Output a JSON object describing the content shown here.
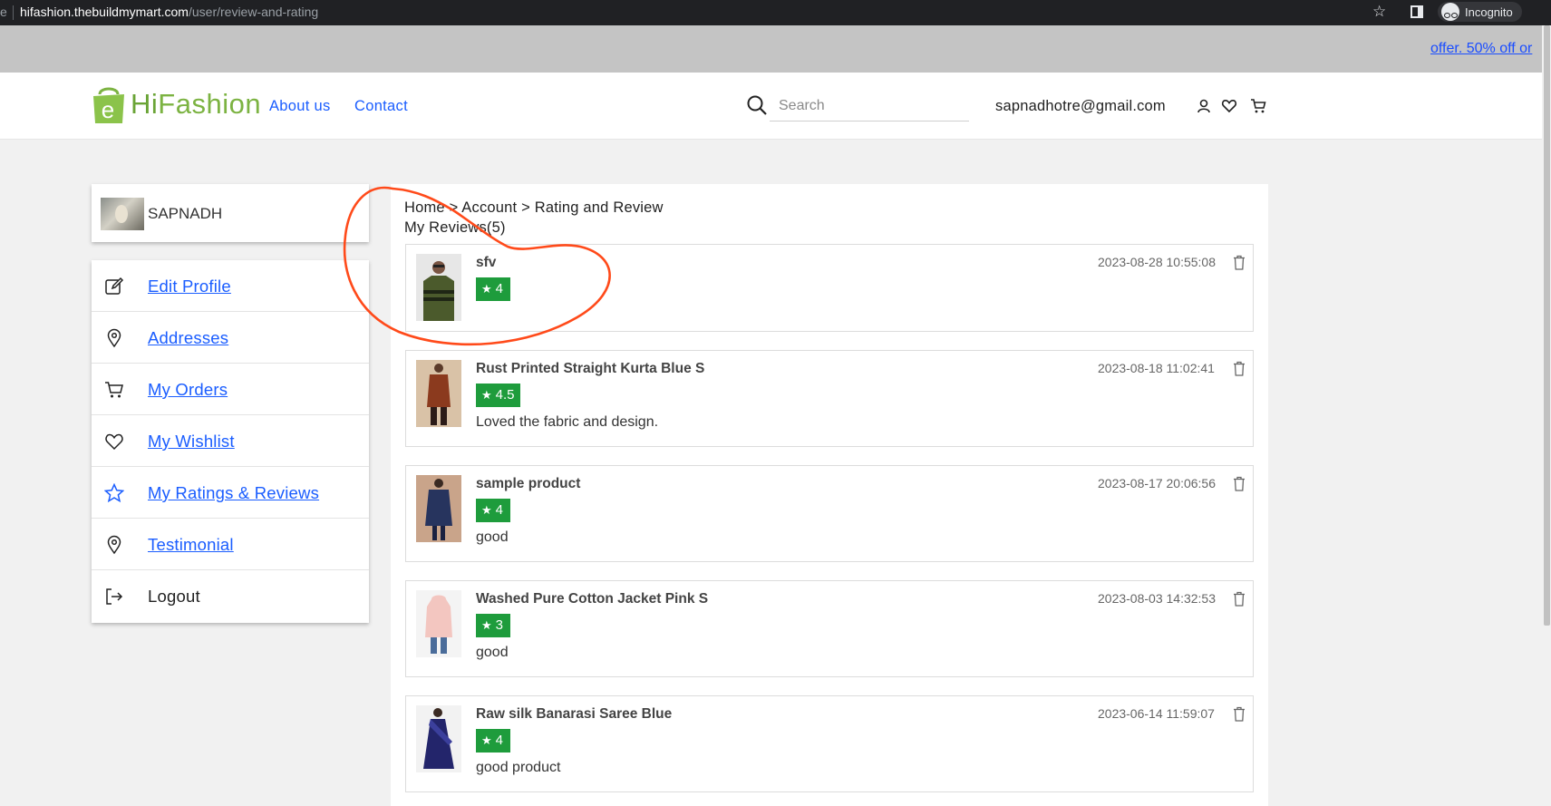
{
  "browser": {
    "url_host": "hifashion.thebuildmymart.com",
    "url_path": "/user/review-and-rating",
    "left_glyph": "e",
    "incognito_label": "Incognito"
  },
  "promo": {
    "text": "offer. 50% off or"
  },
  "header": {
    "brand_hi": "Hi",
    "brand_rest": "Fashion",
    "nav": [
      "About us",
      "Contact"
    ],
    "search_placeholder": "Search",
    "user_email": "sapnadhotre@gmail.com",
    "icons": [
      "user-icon",
      "heart-icon",
      "cart-icon"
    ]
  },
  "sidebar": {
    "username": "SAPNADH",
    "items": [
      {
        "label": "Edit Profile",
        "icon": "edit-icon"
      },
      {
        "label": "Addresses",
        "icon": "location-pin-icon"
      },
      {
        "label": "My Orders",
        "icon": "cart-icon"
      },
      {
        "label": "My Wishlist",
        "icon": "heart-icon"
      },
      {
        "label": "My Ratings & Reviews",
        "icon": "star-icon"
      },
      {
        "label": "Testimonial",
        "icon": "location-pin-icon"
      },
      {
        "label": "Logout",
        "icon": "logout-icon"
      }
    ]
  },
  "content": {
    "breadcrumb": "Home > Account > Rating and Review",
    "title": "My Reviews(5)",
    "reviews": [
      {
        "product": "sfv",
        "rating": "4",
        "text": "",
        "date": "2023-08-28 10:55:08"
      },
      {
        "product": "Rust Printed Straight Kurta Blue S",
        "rating": "4.5",
        "text": "Loved the fabric and design.",
        "date": "2023-08-18 11:02:41"
      },
      {
        "product": "sample product",
        "rating": "4",
        "text": "good",
        "date": "2023-08-17 20:06:56"
      },
      {
        "product": "Washed Pure Cotton Jacket Pink S",
        "rating": "3",
        "text": "good",
        "date": "2023-08-03 14:32:53"
      },
      {
        "product": "Raw silk Banarasi Saree Blue",
        "rating": "4",
        "text": "good product",
        "date": "2023-06-14 11:59:07"
      }
    ]
  },
  "colors": {
    "accent": "#1a5dff",
    "brand": "#7cb342",
    "rating_badge": "#1e9c3c",
    "annotation": "#ff4a1a"
  }
}
